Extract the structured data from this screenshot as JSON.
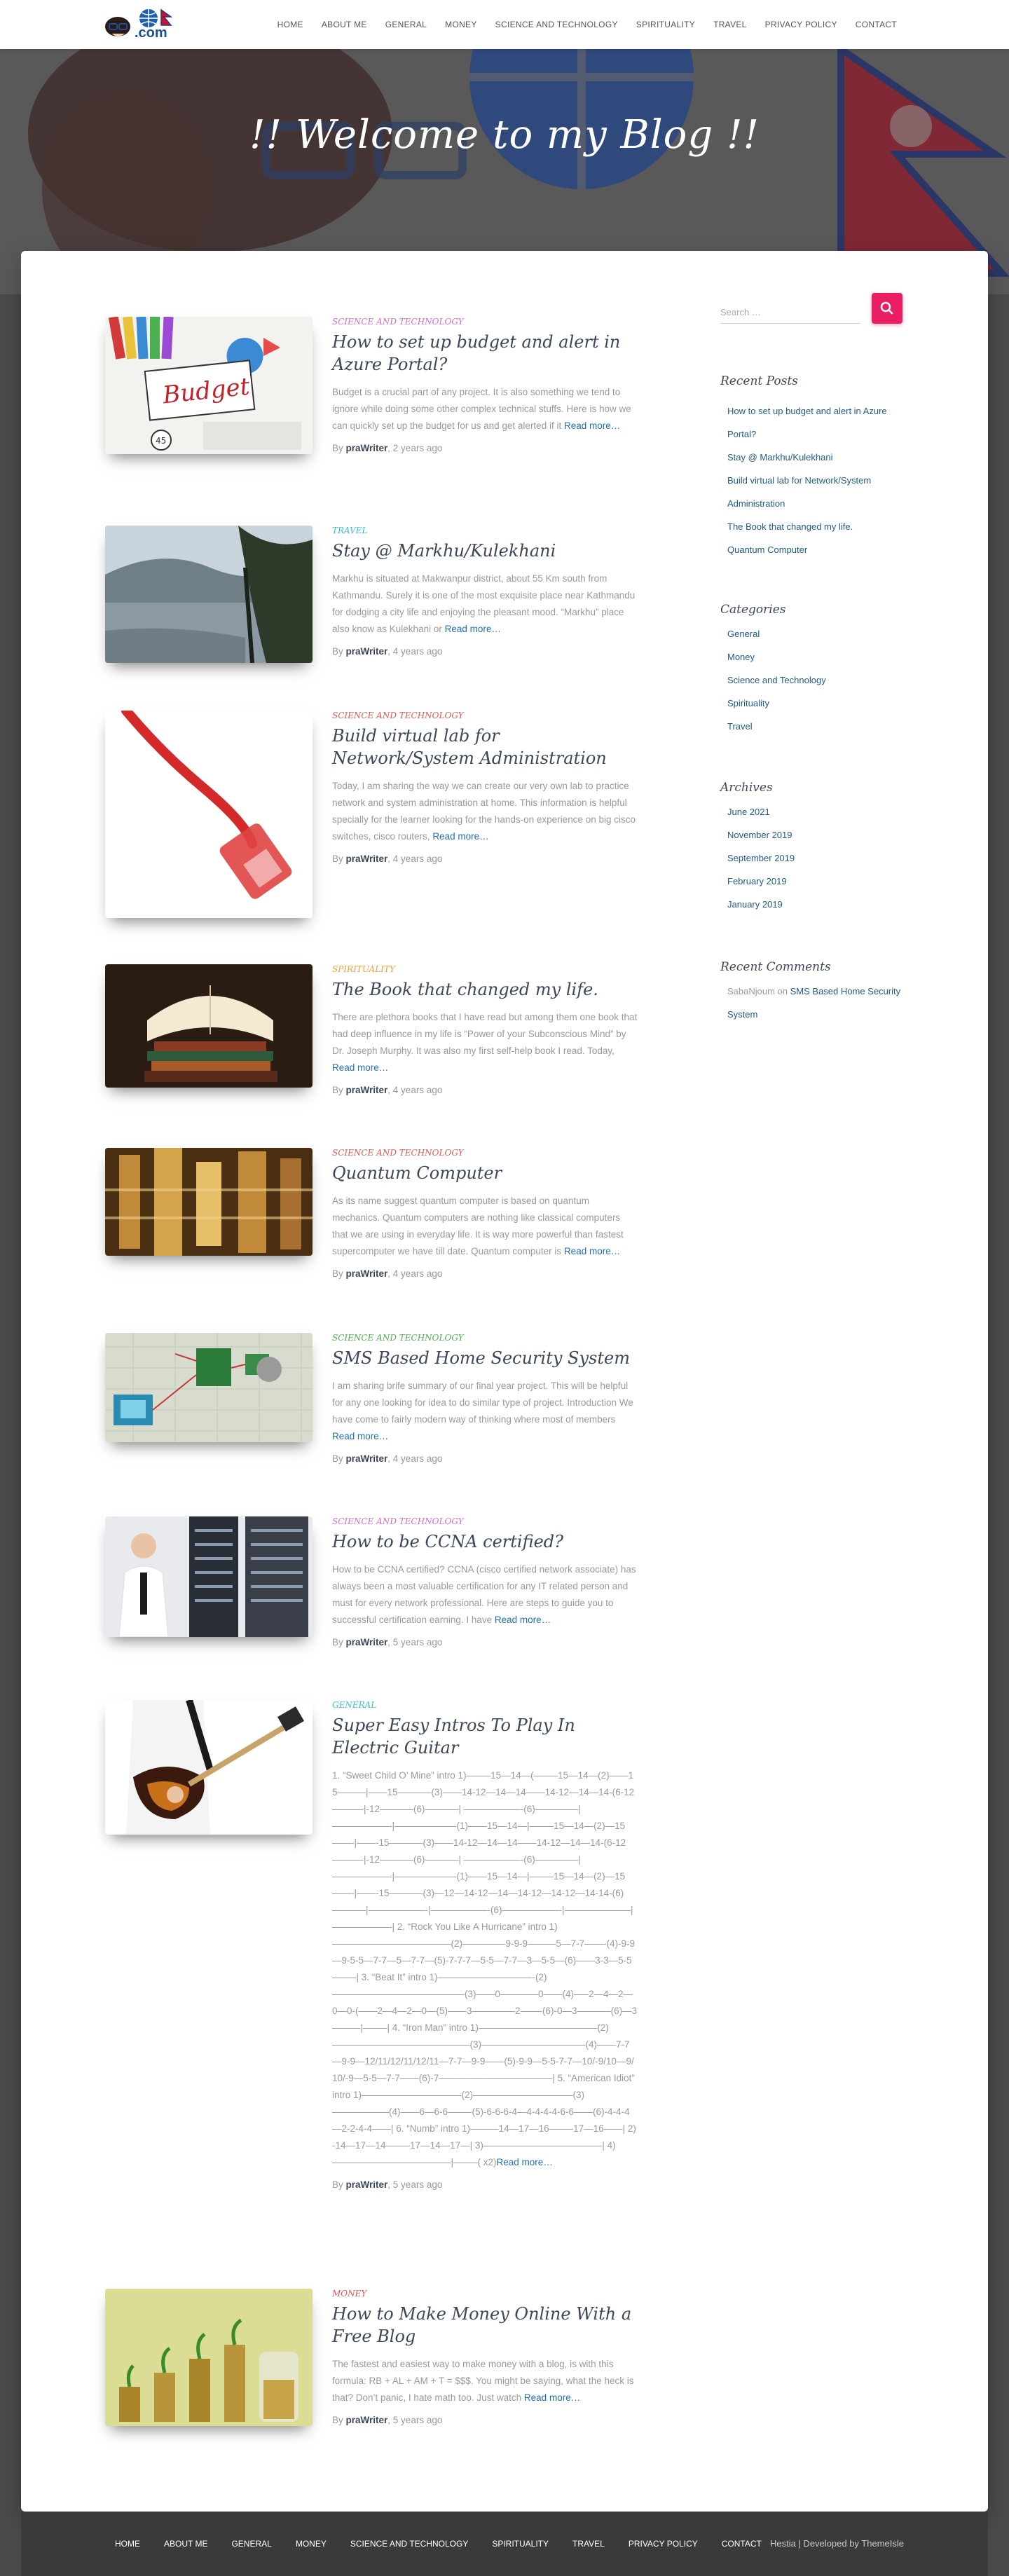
{
  "nav": {
    "logo_text": ".com",
    "items": [
      "HOME",
      "ABOUT ME",
      "GENERAL",
      "MONEY",
      "SCIENCE AND TECHNOLOGY",
      "SPIRITUALITY",
      "TRAVEL",
      "PRIVACY POLICY",
      "CONTACT"
    ]
  },
  "hero": {
    "title": "!! Welcome to my Blog !!"
  },
  "posts": [
    {
      "category": "SCIENCE AND TECHNOLOGY",
      "category_color": "#d16fcf",
      "title": "How to set up budget and alert in Azure Portal?",
      "excerpt": "Budget is a crucial part of any project. It is also something we tend to ignore while doing some other complex technical stuffs. Here is how we can quickly set up the budget for us and get alerted if it",
      "more": "Read more…",
      "by": "By ",
      "author": "praWriter",
      "time": ", 2 years ago",
      "thumb_label": "Budget"
    },
    {
      "category": "TRAVEL",
      "category_color": "#39c0d9",
      "title": "Stay @ Markhu/Kulekhani",
      "excerpt": "Markhu is situated at Makwanpur district, about 55 Km south from Kathmandu. Surely it is one of the most exquisite place near Kathmandu for dodging a city life and enjoying the pleasant mood. “Markhu” place also know as Kulekhani or",
      "more": "Read more…",
      "by": "By ",
      "author": "praWriter",
      "time": ", 4 years ago"
    },
    {
      "category": "SCIENCE AND TECHNOLOGY",
      "category_color": "#e85555",
      "title": "Build virtual lab for Network/System Administration",
      "excerpt": "Today, I am sharing the way we can create our very own lab to practice network and system administration at home. This information is helpful specially for the learner looking for the hands-on experience on big cisco switches, cisco routers,",
      "more": "Read more…",
      "by": "By ",
      "author": "praWriter",
      "time": ", 4 years ago"
    },
    {
      "category": "SPIRITUALITY",
      "category_color": "#e8a33a",
      "title": "The Book that changed my life.",
      "excerpt": "There are plethora books that I have read but among them one book that had deep influence in my life is “Power of your Subconscious Mind” by Dr. Joseph Murphy. It was also my first self-help book I read. Today,",
      "more": "Read more…",
      "by": "By ",
      "author": "praWriter",
      "time": ", 4 years ago"
    },
    {
      "category": "SCIENCE AND TECHNOLOGY",
      "category_color": "#e85555",
      "title": "Quantum Computer",
      "excerpt": "As its name suggest quantum computer is based on quantum mechanics. Quantum computers are nothing like classical computers that we are using in everyday life. It is way more powerful than fastest supercomputer we have till date. Quantum computer is",
      "more": "Read more…",
      "by": "By ",
      "author": "praWriter",
      "time": ", 4 years ago"
    },
    {
      "category": "SCIENCE AND TECHNOLOGY",
      "category_color": "#4caf50",
      "title": "SMS Based Home Security System",
      "excerpt": "I am sharing brife summary of our final year project. This will be helpful for any one looking for idea to do similar type of project. Introduction We have come to fairly modern way of thinking where most of members",
      "more": "Read more…",
      "by": "By ",
      "author": "praWriter",
      "time": ", 4 years ago"
    },
    {
      "category": "SCIENCE AND TECHNOLOGY",
      "category_color": "#d16fcf",
      "title": "How to be CCNA certified?",
      "excerpt": "How to be CCNA certified? CCNA (cisco certified network associate) has always been a most valuable certification for any IT related person and must for every network professional. Here are steps to guide you to successful certification earning. I have",
      "more": "Read more…",
      "by": "By ",
      "author": "praWriter",
      "time": ", 5 years ago"
    },
    {
      "category": "GENERAL",
      "category_color": "#39c0d9",
      "title": "Super Easy Intros To Play In Electric Guitar",
      "excerpt": "1. “Sweet Child O’ Mine” intro 1)——–15—14—(——–15—14—(2)——15———|——15———–(3)——14-12—14—14——14-12—14—14-(6-12———-|-12———–(6)———–| ——————-(6)————–|——————-|——————–(1)——15—14—|——–15—14—(2)—15——-|——-15———–(3)——14-12—14—14——14-12—14—14-(6-12———-|-12———–(6)———–| ——————-(6)————–|——————-|——————–(1)——15—14—|——–15—14—(2)—15——-|——-15———–(3)—12—14-12—14—14-12—14-12—14-14-(6)———–|——————-|——————-(6)——————-|———————|——————-| 2. “Rock You Like A Hurricane” intro 1)————————————–(2)————–9-9-9———5—7-7——-(4)-9-9—9-5-5—7-7—5—7-7—(5)-7-7-7—5-5—7-7—3—5-5—(6)——3-3—5-5——–| 3. “Beat It” intro 1)——————————-(2)——————————————(3)——0————0——(4)—–2—4—2—0—0-(——2—4—2—0—(5)——3————–2——-(6)-0—3———–(6)—3———|——–| 4. “Iron Man” intro 1)————————————–(2)——————————————–(3)———————————(4)——7-7—9-9—12/11/12/11/12/11—7-7—9-9——(5)-9-9—5-5-7-7—10/-9/10—9/10/-9—5-5—7-7——(6)-7————————————| 5. “American Idiot” intro 1)——————————–(2)——————————–(3)——————(4)——6—6-6——–(5)-6-6-6-4—4-4-4-4-6-6——(6)-4-4-4—2-2-4-4——| 6. “Numb” intro 1)———14—17—16——–17—16——| 2)-14—17—14——–17—14—17—| 3)————————————–| 4)————————————–|——–( x2)",
      "more": "Read more…",
      "by": "By ",
      "author": "praWriter",
      "time": ", 5 years ago"
    },
    {
      "category": "MONEY",
      "category_color": "#e85555",
      "title": "How to Make Money Online With a Free Blog",
      "excerpt": "The fastest and easiest way to make money with a blog, is with this formula: RB + AL + AM + T = $$$. You might be saying, what the heck is that? Don’t panic, I hate math too. Just watch",
      "more": "Read more…",
      "by": "By ",
      "author": "praWriter",
      "time": ", 5 years ago"
    }
  ],
  "sidebar": {
    "search_placeholder": "Search …",
    "recent_posts_title": "Recent Posts",
    "recent_posts": [
      "How to set up budget and alert in Azure Portal?",
      "Stay @ Markhu/Kulekhani",
      "Build virtual lab for Network/System Administration",
      "The Book that changed my life.",
      "Quantum Computer"
    ],
    "categories_title": "Categories",
    "categories": [
      "General",
      "Money",
      "Science and Technology",
      "Spirituality",
      "Travel"
    ],
    "archives_title": "Archives",
    "archives": [
      "June 2021",
      "November 2019",
      "September 2019",
      "February 2019",
      "January 2019"
    ],
    "comments_title": "Recent Comments",
    "comment_author": "SabaNjoum",
    "comment_on": " on ",
    "comment_post": "SMS Based Home Security System"
  },
  "footer": {
    "items": [
      "HOME",
      "ABOUT ME",
      "GENERAL",
      "MONEY",
      "SCIENCE AND TECHNOLOGY",
      "SPIRITUALITY",
      "TRAVEL",
      "PRIVACY POLICY",
      "CONTACT"
    ],
    "credit": "Hestia | Developed by ThemeIsle"
  },
  "colors": {
    "accent": "#e91e63",
    "link": "#1f5a8a"
  }
}
